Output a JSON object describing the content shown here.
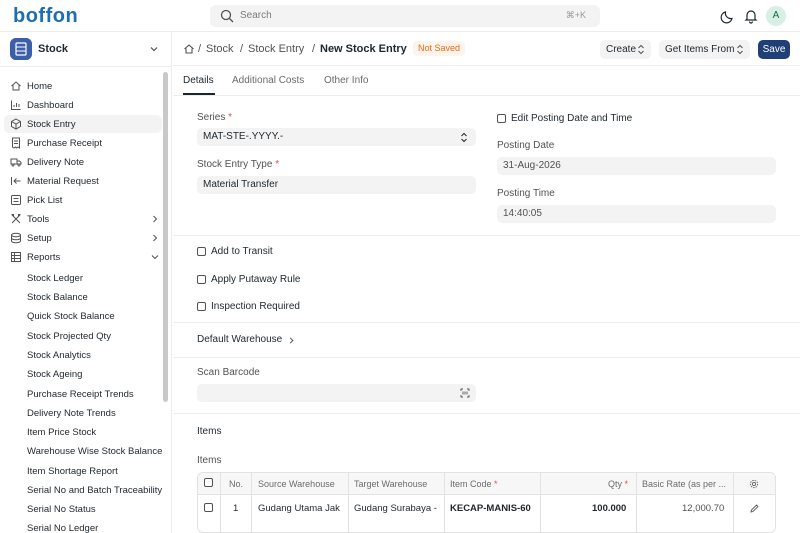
{
  "app": {
    "logo": "boffon"
  },
  "search": {
    "placeholder": "Search",
    "shortcut": "⌘+K"
  },
  "user": {
    "avatar_letter": "A"
  },
  "workspace": {
    "name": "Stock"
  },
  "sidebar": {
    "items": [
      {
        "label": "Home",
        "icon": "home-icon"
      },
      {
        "label": "Dashboard",
        "icon": "chart-icon"
      },
      {
        "label": "Stock Entry",
        "icon": "box-icon",
        "active": true
      },
      {
        "label": "Purchase Receipt",
        "icon": "receipt-icon"
      },
      {
        "label": "Delivery Note",
        "icon": "truck-icon"
      },
      {
        "label": "Material Request",
        "icon": "arrow-left-bar-icon"
      },
      {
        "label": "Pick List",
        "icon": "list-icon"
      },
      {
        "label": "Tools",
        "icon": "tools-icon",
        "expandable": true
      },
      {
        "label": "Setup",
        "icon": "database-icon",
        "expandable": true
      },
      {
        "label": "Reports",
        "icon": "table-icon",
        "expanded": true
      }
    ],
    "reports": [
      "Stock Ledger",
      "Stock Balance",
      "Quick Stock Balance",
      "Stock Projected Qty",
      "Stock Analytics",
      "Stock Ageing",
      "Purchase Receipt Trends",
      "Delivery Note Trends",
      "Item Price Stock",
      "Warehouse Wise Stock Balance",
      "Item Shortage Report",
      "Serial No and Batch Traceability",
      "Serial No Status",
      "Serial No Ledger"
    ]
  },
  "header": {
    "breadcrumbs": [
      "Stock",
      "Stock Entry"
    ],
    "title": "New Stock Entry",
    "status": "Not Saved",
    "create_label": "Create",
    "get_items_label": "Get Items From",
    "save_label": "Save"
  },
  "tabs": [
    "Details",
    "Additional Costs",
    "Other Info"
  ],
  "form": {
    "series_label": "Series",
    "series_value": "MAT-STE-.YYYY.-",
    "entry_type_label": "Stock Entry Type",
    "entry_type_value": "Material Transfer",
    "edit_posting_label": "Edit Posting Date and Time",
    "posting_date_label": "Posting Date",
    "posting_date_value": "31-Aug-2026",
    "posting_time_label": "Posting Time",
    "posting_time_value": "14:40:05",
    "add_to_transit": "Add to Transit",
    "apply_putaway": "Apply Putaway Rule",
    "inspection_required": "Inspection Required",
    "default_warehouse": "Default Warehouse",
    "scan_barcode_label": "Scan Barcode",
    "items_section": "Items",
    "items_label": "Items"
  },
  "table": {
    "headers": {
      "no": "No.",
      "source": "Source Warehouse",
      "target": "Target Warehouse",
      "item_code": "Item Code",
      "qty": "Qty",
      "rate": "Basic Rate (as per ..."
    },
    "rows": [
      {
        "no": "1",
        "source": "Gudang Utama Jak",
        "target": "Gudang Surabaya -",
        "item_code": "KECAP-MANIS-60",
        "qty": "100.000",
        "rate": "12,000.70"
      }
    ]
  }
}
